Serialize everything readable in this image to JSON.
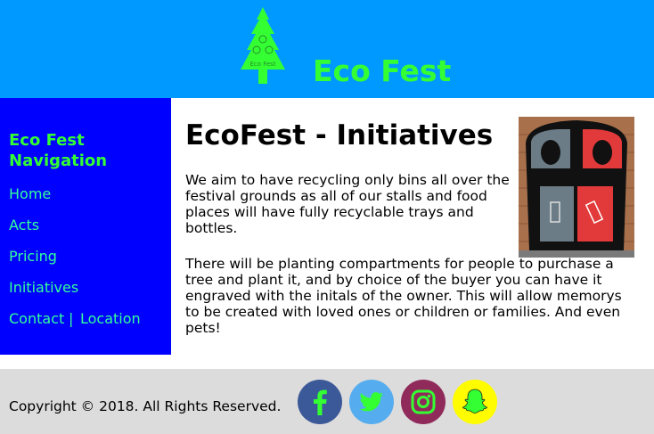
{
  "header": {
    "site_title": "Eco Fest",
    "logo_text": "Eco Fest",
    "logo_icon": "pine-tree-logo"
  },
  "sidebar": {
    "heading": "Eco Fest Navigation",
    "items": [
      {
        "label": "Home"
      },
      {
        "label": "Acts"
      },
      {
        "label": "Pricing"
      },
      {
        "label": "Initiatives"
      },
      {
        "label": "Contact"
      },
      {
        "label": "Location"
      }
    ],
    "separator": "|"
  },
  "main": {
    "title": "EcoFest - Initiatives",
    "paragraphs": [
      "We aim to have recycling only bins all over the festival grounds as all of our stalls and food places will have fully recyclable trays and bottles.",
      "There will be planting compartments for people to purchase a tree and plant it, and by choice of the buyer you can have it engraved with the initals of the owner. This will allow memorys to be created with loved ones or children or families. And even pets!"
    ],
    "image": "recycling-bin-photo"
  },
  "footer": {
    "copyright": "Copyright © 2018. All Rights Reserved.",
    "social": [
      {
        "name": "facebook",
        "icon": "facebook-icon",
        "color": "#3b5998"
      },
      {
        "name": "twitter",
        "icon": "twitter-icon",
        "color": "#55acee"
      },
      {
        "name": "instagram",
        "icon": "instagram-icon",
        "color": "#8f2a5a"
      },
      {
        "name": "snapchat",
        "icon": "snapchat-icon",
        "color": "#fffc00"
      }
    ]
  },
  "colors": {
    "header_bg": "#0099ff",
    "sidebar_bg": "#0000ff",
    "accent_green": "#33ff33",
    "footer_bg": "#dcdcdc"
  }
}
